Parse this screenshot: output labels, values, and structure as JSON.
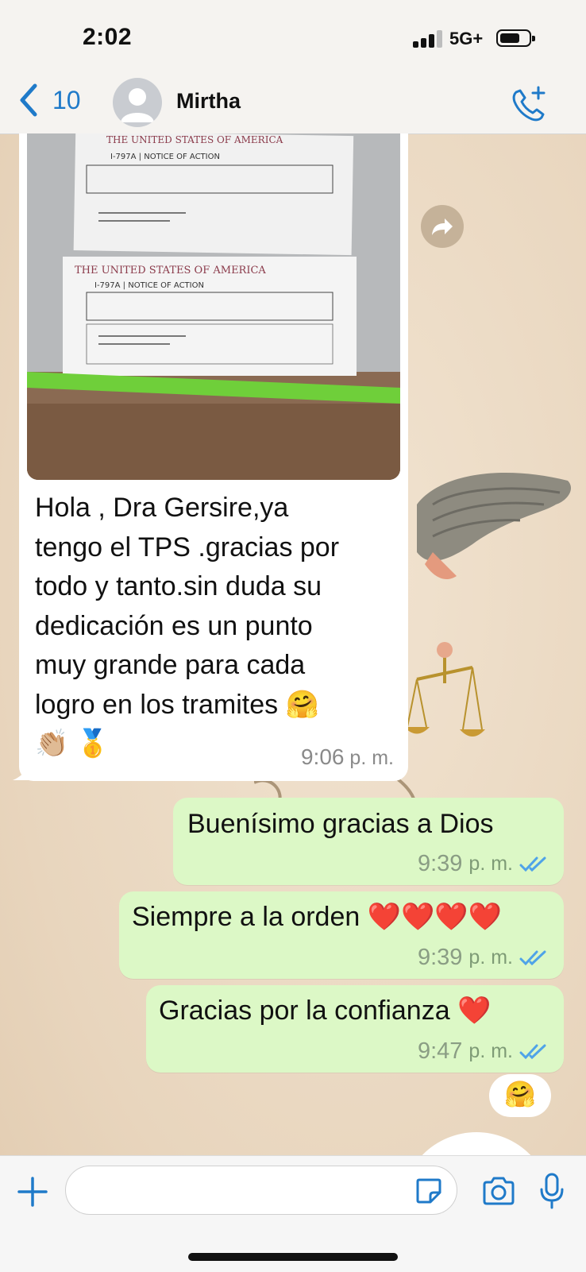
{
  "status_bar": {
    "time": "2:02",
    "network": "5G+"
  },
  "header": {
    "back_count": "10",
    "contact_name": "Mirtha"
  },
  "messages": {
    "incoming": {
      "text": "Hola , Dra Gersire,ya\ntengo el TPS .gracias por\ntodo y tanto.sin duda su\ndedicación es un punto\nmuy grande para cada\nlogro en los tramites 🤗\n👏🏼 🥇",
      "time": "9:06",
      "ampm": "p. m.",
      "photo_caption_1": "THE UNITED STATES OF AMERICA",
      "photo_form_1": "I-797A | NOTICE OF ACTION",
      "photo_caption_2": "THE UNITED STATES OF AMERICA",
      "photo_form_2": "I-797A | NOTICE OF ACTION"
    },
    "outgoing": [
      {
        "text": "Buenísimo gracias a Dios",
        "time": "9:39",
        "ampm": "p. m."
      },
      {
        "text": "Siempre a la orden ❤️❤️❤️❤️",
        "time": "9:39",
        "ampm": "p. m."
      },
      {
        "text": "Gracias por la confianza ❤️",
        "time": "9:47",
        "ampm": "p. m."
      }
    ],
    "reaction_emoji": "🤗"
  },
  "composer": {
    "placeholder": ""
  },
  "colors": {
    "accent": "#1f7ac9",
    "outgoing_bubble": "#dcf8c6",
    "read_ticks": "#4fa3e8"
  }
}
